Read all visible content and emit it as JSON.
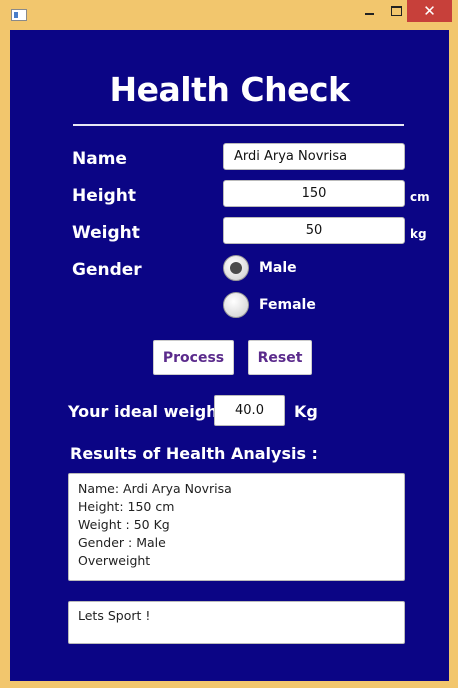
{
  "window": {
    "min_glyph": "",
    "close_glyph": "✕"
  },
  "app": {
    "title": "Health Check",
    "labels": {
      "name": "Name",
      "height": "Height",
      "weight": "Weight",
      "gender": "Gender"
    },
    "fields": {
      "name": "Ardi Arya Novrisa",
      "height": "150",
      "weight": "50"
    },
    "units": {
      "height": "cm",
      "weight": "kg"
    },
    "gender_options": [
      {
        "label": "Male",
        "selected": true
      },
      {
        "label": "Female",
        "selected": false
      }
    ],
    "buttons": {
      "process": "Process",
      "reset": "Reset"
    },
    "ideal": {
      "label": "Your ideal weight",
      "value": "40.0",
      "unit": "Kg"
    },
    "results": {
      "label": "Results of Health Analysis :",
      "lines": [
        "Name: Ardi Arya Novrisa",
        "Height: 150 cm",
        "Weight : 50 Kg",
        "Gender : Male",
        "Overweight"
      ]
    },
    "advice": "Lets Sport !"
  },
  "colors": {
    "frame": "#f2c66d",
    "background": "#0b0585",
    "close_button": "#c7403a",
    "button_text": "#5b2b8c"
  }
}
